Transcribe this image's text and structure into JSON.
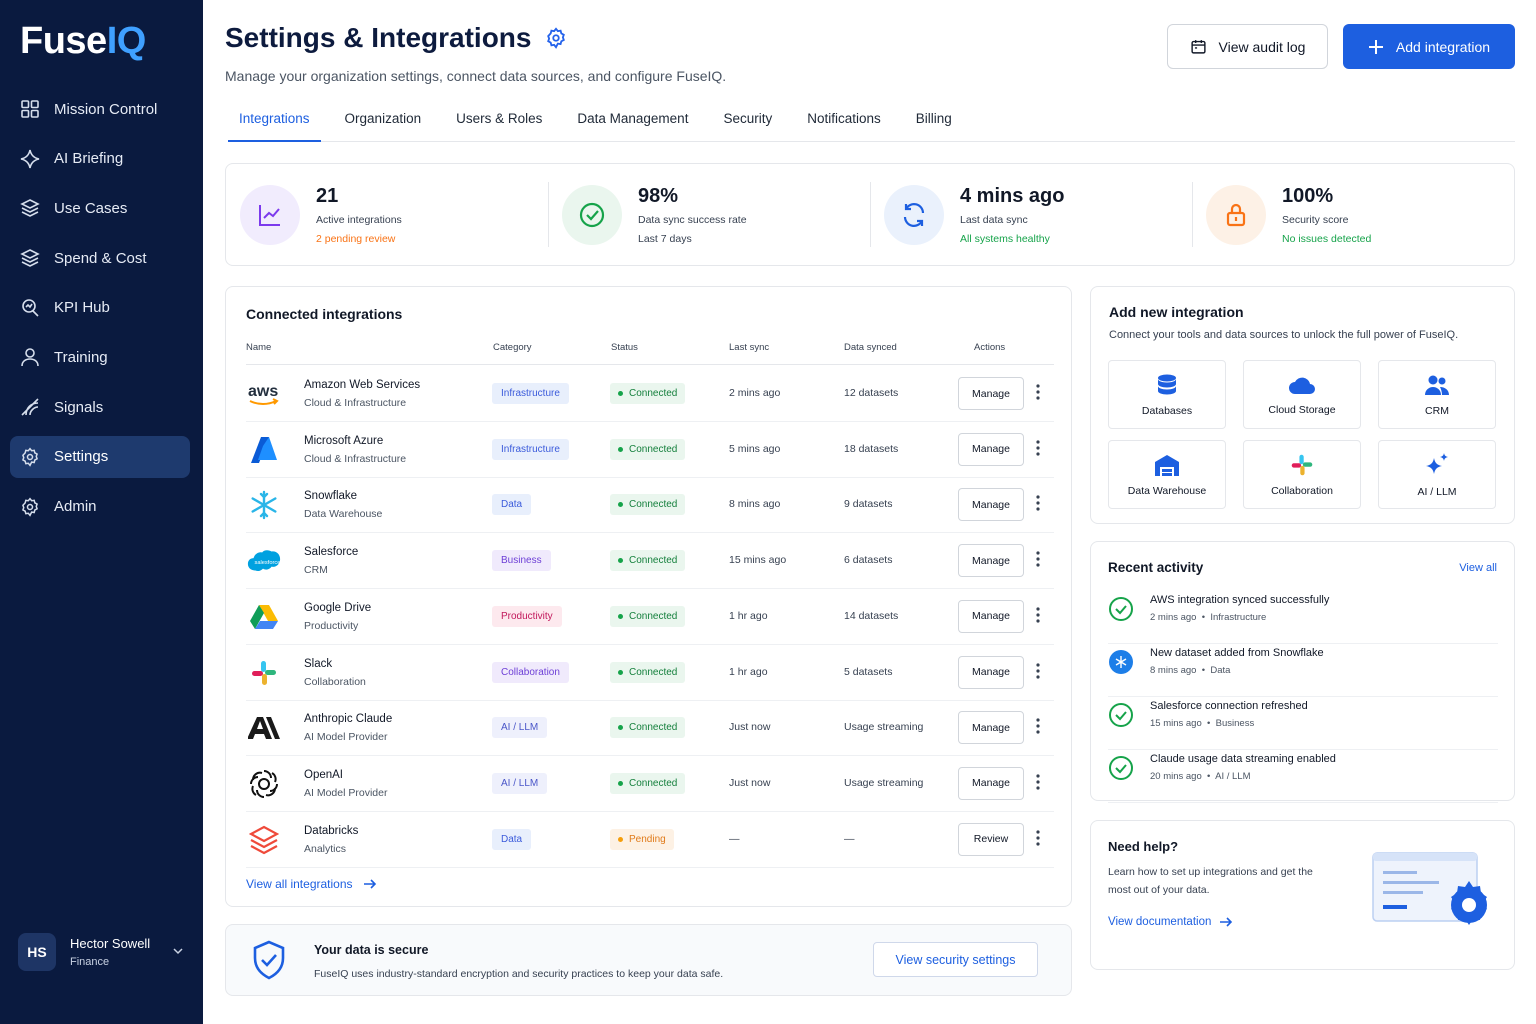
{
  "brand": {
    "part1": "Fuse",
    "part2": "IQ"
  },
  "sidebar": {
    "items": [
      {
        "label": "Mission Control",
        "icon": "grid-icon"
      },
      {
        "label": "AI Briefing",
        "icon": "sparkle-icon"
      },
      {
        "label": "Use Cases",
        "icon": "layers-icon"
      },
      {
        "label": "Spend & Cost",
        "icon": "layers-icon"
      },
      {
        "label": "KPI Hub",
        "icon": "kpi-icon"
      },
      {
        "label": "Training",
        "icon": "user-icon"
      },
      {
        "label": "Signals",
        "icon": "signal-icon"
      },
      {
        "label": "Settings",
        "icon": "gear-icon"
      },
      {
        "label": "Admin",
        "icon": "gear-icon"
      }
    ],
    "active": "Settings",
    "user": {
      "initials": "HS",
      "name": "Hector Sowell",
      "role": "Finance"
    }
  },
  "header": {
    "title": "Settings & Integrations",
    "subtitle": "Manage your organization settings, connect data sources, and configure FuseIQ.",
    "audit_label": "View audit log",
    "add_label": "Add integration"
  },
  "tabs": [
    "Integrations",
    "Organization",
    "Users & Roles",
    "Data Management",
    "Security",
    "Notifications",
    "Billing"
  ],
  "active_tab": "Integrations",
  "stats": [
    {
      "value": "21",
      "label": "Active integrations",
      "sub": "2 pending review",
      "sub_color": "#f97316",
      "icon": "chart-icon"
    },
    {
      "value": "98%",
      "label": "Data sync success rate",
      "sub": "Last 7 days",
      "sub_color": "#374151",
      "icon": "check-circle-icon"
    },
    {
      "value": "4 mins ago",
      "label": "Last data sync",
      "sub": "All systems healthy",
      "sub_color": "#16a34a",
      "icon": "refresh-icon"
    },
    {
      "value": "100%",
      "label": "Security score",
      "sub": "No issues detected",
      "sub_color": "#16a34a",
      "icon": "lock-icon"
    }
  ],
  "connected": {
    "title": "Connected integrations",
    "columns": [
      "Name",
      "Category",
      "Status",
      "Last sync",
      "Data synced",
      "Actions"
    ],
    "rows": [
      {
        "name": "Amazon Web Services",
        "desc": "Cloud & Infrastructure",
        "category": "Infrastructure",
        "status": "Connected",
        "last_sync": "2 mins ago",
        "data": "12 datasets",
        "action": "Manage",
        "logo": "aws"
      },
      {
        "name": "Microsoft Azure",
        "desc": "Cloud & Infrastructure",
        "category": "Infrastructure",
        "status": "Connected",
        "last_sync": "5 mins ago",
        "data": "18 datasets",
        "action": "Manage",
        "logo": "azure"
      },
      {
        "name": "Snowflake",
        "desc": "Data Warehouse",
        "category": "Data",
        "status": "Connected",
        "last_sync": "8 mins ago",
        "data": "9 datasets",
        "action": "Manage",
        "logo": "snowflake"
      },
      {
        "name": "Salesforce",
        "desc": "CRM",
        "category": "Business",
        "status": "Connected",
        "last_sync": "15 mins ago",
        "data": "6 datasets",
        "action": "Manage",
        "logo": "salesforce"
      },
      {
        "name": "Google Drive",
        "desc": "Productivity",
        "category": "Productivity",
        "status": "Connected",
        "last_sync": "1 hr ago",
        "data": "14 datasets",
        "action": "Manage",
        "logo": "gdrive"
      },
      {
        "name": "Slack",
        "desc": "Collaboration",
        "category": "Collaboration",
        "status": "Connected",
        "last_sync": "1 hr ago",
        "data": "5 datasets",
        "action": "Manage",
        "logo": "slack"
      },
      {
        "name": "Anthropic Claude",
        "desc": "AI Model Provider",
        "category": "AI / LLM",
        "status": "Connected",
        "last_sync": "Just now",
        "data": "Usage streaming",
        "action": "Manage",
        "logo": "anthropic"
      },
      {
        "name": "OpenAI",
        "desc": "AI Model Provider",
        "category": "AI / LLM",
        "status": "Connected",
        "last_sync": "Just now",
        "data": "Usage streaming",
        "action": "Manage",
        "logo": "openai"
      },
      {
        "name": "Databricks",
        "desc": "Analytics",
        "category": "Data",
        "status": "Pending",
        "last_sync": "—",
        "data": "—",
        "action": "Review",
        "logo": "databricks"
      }
    ],
    "view_all": "View all integrations"
  },
  "security": {
    "title": "Your data is secure",
    "desc": "FuseIQ uses industry-standard encryption and security practices to keep your data safe.",
    "button": "View security settings"
  },
  "add_new": {
    "title": "Add new integration",
    "desc": "Connect your tools and data sources to unlock the full power of FuseIQ.",
    "tiles": [
      {
        "label": "Databases",
        "icon": "database-icon"
      },
      {
        "label": "Cloud Storage",
        "icon": "cloud-icon"
      },
      {
        "label": "CRM",
        "icon": "users-icon"
      },
      {
        "label": "Data Warehouse",
        "icon": "warehouse-icon"
      },
      {
        "label": "Collaboration",
        "icon": "slack-icon"
      },
      {
        "label": "AI / LLM",
        "icon": "sparkle-icon"
      }
    ]
  },
  "recent": {
    "title": "Recent activity",
    "view_all": "View all",
    "items": [
      {
        "text": "AWS integration synced successfully",
        "time": "2 mins ago",
        "tag": "Infrastructure",
        "icon": "check"
      },
      {
        "text": "New dataset added from Snowflake",
        "time": "8 mins ago",
        "tag": "Data",
        "icon": "snowflake"
      },
      {
        "text": "Salesforce connection refreshed",
        "time": "15 mins ago",
        "tag": "Business",
        "icon": "check"
      },
      {
        "text": "Claude usage data streaming enabled",
        "time": "20 mins ago",
        "tag": "AI / LLM",
        "icon": "check"
      }
    ]
  },
  "help": {
    "title": "Need help?",
    "desc": "Learn how to set up integrations and get the most out of your data.",
    "link": "View documentation"
  },
  "colors": {
    "sidebar": "#0a1a3f",
    "accent": "#1d5fe0",
    "success": "#16a34a",
    "warning": "#f97316"
  }
}
